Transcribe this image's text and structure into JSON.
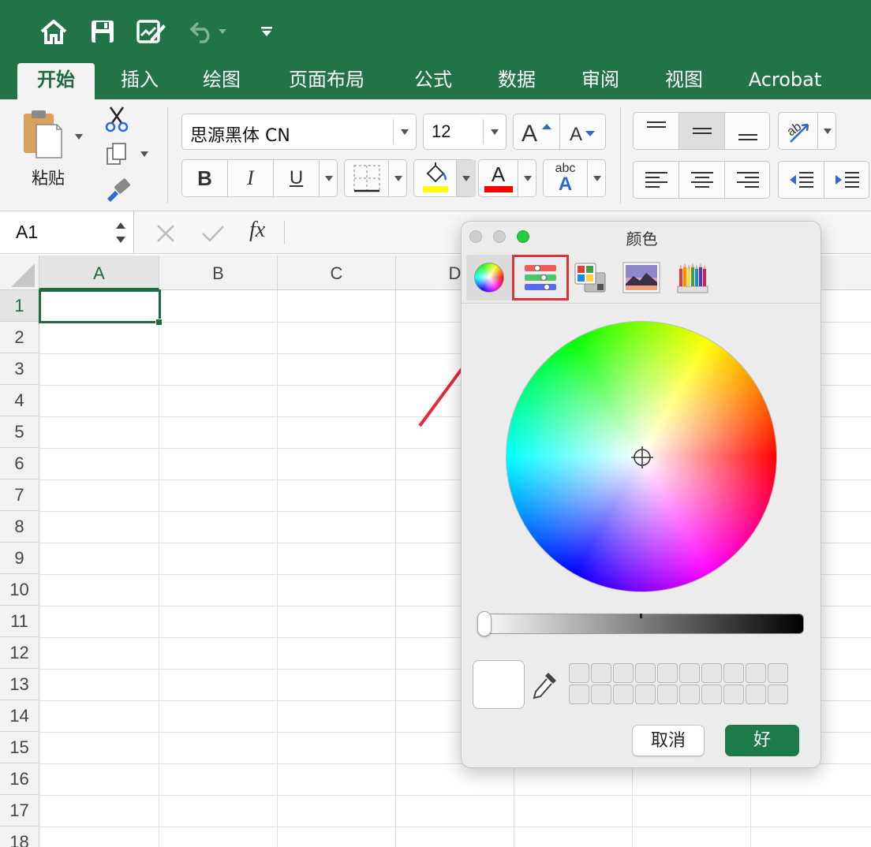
{
  "toolbar": {
    "icons": [
      "home-icon",
      "save-icon",
      "edit-document-icon",
      "undo-icon",
      "customize-toolbar-icon"
    ]
  },
  "tabs": [
    {
      "label": "开始",
      "active": true
    },
    {
      "label": "插入"
    },
    {
      "label": "绘图"
    },
    {
      "label": "页面布局"
    },
    {
      "label": "公式"
    },
    {
      "label": "数据"
    },
    {
      "label": "审阅"
    },
    {
      "label": "视图"
    },
    {
      "label": "Acrobat"
    }
  ],
  "ribbon": {
    "paste_label": "粘贴",
    "font_name": "思源黑体 CN",
    "font_size": "12",
    "bold": "B",
    "italic": "I",
    "underline": "U",
    "text_effect": "abc",
    "font_color_letter": "A",
    "highlight_color": "#ffff00",
    "font_color": "#ff0000"
  },
  "formula_bar": {
    "name_box": "A1",
    "fx": "fx"
  },
  "sheet": {
    "columns": [
      "A",
      "B",
      "C",
      "D"
    ],
    "rows": [
      "1",
      "2",
      "3",
      "4",
      "5",
      "6",
      "7",
      "8",
      "9",
      "10",
      "11",
      "12",
      "13",
      "14",
      "15",
      "16",
      "17",
      "18"
    ],
    "selected_cell": "A1"
  },
  "color_dialog": {
    "title": "颜色",
    "modes": [
      "color-wheel-icon",
      "color-sliders-icon",
      "color-palettes-icon",
      "image-palettes-icon",
      "pencils-icon"
    ],
    "active_mode": "color-wheel-icon",
    "highlighted_mode": "color-sliders-icon",
    "current_color": "#ffffff",
    "brightness": 0,
    "cancel_label": "取消",
    "ok_label": "好"
  },
  "colors": {
    "excel_green": "#227447",
    "ok_green": "#1e7a4a",
    "highlight_box": "#e0303a",
    "arrow": "#e8283a"
  }
}
